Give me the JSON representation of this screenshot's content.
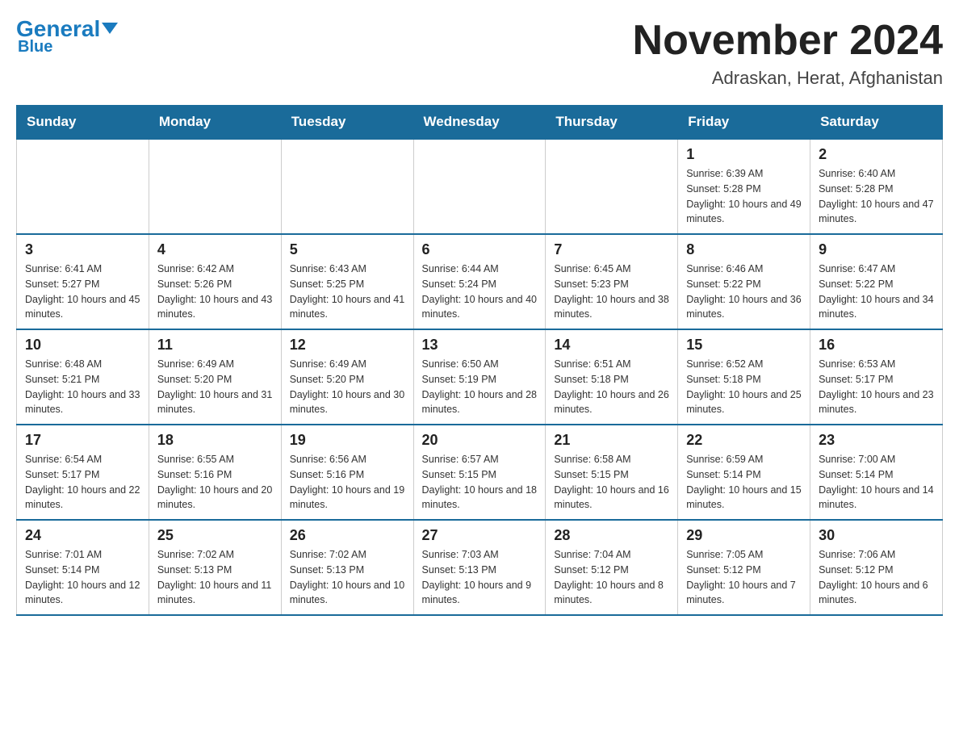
{
  "logo": {
    "general": "General",
    "blue": "Blue"
  },
  "header": {
    "month_title": "November 2024",
    "location": "Adraskan, Herat, Afghanistan"
  },
  "weekdays": [
    "Sunday",
    "Monday",
    "Tuesday",
    "Wednesday",
    "Thursday",
    "Friday",
    "Saturday"
  ],
  "weeks": [
    [
      {
        "day": "",
        "info": ""
      },
      {
        "day": "",
        "info": ""
      },
      {
        "day": "",
        "info": ""
      },
      {
        "day": "",
        "info": ""
      },
      {
        "day": "",
        "info": ""
      },
      {
        "day": "1",
        "info": "Sunrise: 6:39 AM\nSunset: 5:28 PM\nDaylight: 10 hours and 49 minutes."
      },
      {
        "day": "2",
        "info": "Sunrise: 6:40 AM\nSunset: 5:28 PM\nDaylight: 10 hours and 47 minutes."
      }
    ],
    [
      {
        "day": "3",
        "info": "Sunrise: 6:41 AM\nSunset: 5:27 PM\nDaylight: 10 hours and 45 minutes."
      },
      {
        "day": "4",
        "info": "Sunrise: 6:42 AM\nSunset: 5:26 PM\nDaylight: 10 hours and 43 minutes."
      },
      {
        "day": "5",
        "info": "Sunrise: 6:43 AM\nSunset: 5:25 PM\nDaylight: 10 hours and 41 minutes."
      },
      {
        "day": "6",
        "info": "Sunrise: 6:44 AM\nSunset: 5:24 PM\nDaylight: 10 hours and 40 minutes."
      },
      {
        "day": "7",
        "info": "Sunrise: 6:45 AM\nSunset: 5:23 PM\nDaylight: 10 hours and 38 minutes."
      },
      {
        "day": "8",
        "info": "Sunrise: 6:46 AM\nSunset: 5:22 PM\nDaylight: 10 hours and 36 minutes."
      },
      {
        "day": "9",
        "info": "Sunrise: 6:47 AM\nSunset: 5:22 PM\nDaylight: 10 hours and 34 minutes."
      }
    ],
    [
      {
        "day": "10",
        "info": "Sunrise: 6:48 AM\nSunset: 5:21 PM\nDaylight: 10 hours and 33 minutes."
      },
      {
        "day": "11",
        "info": "Sunrise: 6:49 AM\nSunset: 5:20 PM\nDaylight: 10 hours and 31 minutes."
      },
      {
        "day": "12",
        "info": "Sunrise: 6:49 AM\nSunset: 5:20 PM\nDaylight: 10 hours and 30 minutes."
      },
      {
        "day": "13",
        "info": "Sunrise: 6:50 AM\nSunset: 5:19 PM\nDaylight: 10 hours and 28 minutes."
      },
      {
        "day": "14",
        "info": "Sunrise: 6:51 AM\nSunset: 5:18 PM\nDaylight: 10 hours and 26 minutes."
      },
      {
        "day": "15",
        "info": "Sunrise: 6:52 AM\nSunset: 5:18 PM\nDaylight: 10 hours and 25 minutes."
      },
      {
        "day": "16",
        "info": "Sunrise: 6:53 AM\nSunset: 5:17 PM\nDaylight: 10 hours and 23 minutes."
      }
    ],
    [
      {
        "day": "17",
        "info": "Sunrise: 6:54 AM\nSunset: 5:17 PM\nDaylight: 10 hours and 22 minutes."
      },
      {
        "day": "18",
        "info": "Sunrise: 6:55 AM\nSunset: 5:16 PM\nDaylight: 10 hours and 20 minutes."
      },
      {
        "day": "19",
        "info": "Sunrise: 6:56 AM\nSunset: 5:16 PM\nDaylight: 10 hours and 19 minutes."
      },
      {
        "day": "20",
        "info": "Sunrise: 6:57 AM\nSunset: 5:15 PM\nDaylight: 10 hours and 18 minutes."
      },
      {
        "day": "21",
        "info": "Sunrise: 6:58 AM\nSunset: 5:15 PM\nDaylight: 10 hours and 16 minutes."
      },
      {
        "day": "22",
        "info": "Sunrise: 6:59 AM\nSunset: 5:14 PM\nDaylight: 10 hours and 15 minutes."
      },
      {
        "day": "23",
        "info": "Sunrise: 7:00 AM\nSunset: 5:14 PM\nDaylight: 10 hours and 14 minutes."
      }
    ],
    [
      {
        "day": "24",
        "info": "Sunrise: 7:01 AM\nSunset: 5:14 PM\nDaylight: 10 hours and 12 minutes."
      },
      {
        "day": "25",
        "info": "Sunrise: 7:02 AM\nSunset: 5:13 PM\nDaylight: 10 hours and 11 minutes."
      },
      {
        "day": "26",
        "info": "Sunrise: 7:02 AM\nSunset: 5:13 PM\nDaylight: 10 hours and 10 minutes."
      },
      {
        "day": "27",
        "info": "Sunrise: 7:03 AM\nSunset: 5:13 PM\nDaylight: 10 hours and 9 minutes."
      },
      {
        "day": "28",
        "info": "Sunrise: 7:04 AM\nSunset: 5:12 PM\nDaylight: 10 hours and 8 minutes."
      },
      {
        "day": "29",
        "info": "Sunrise: 7:05 AM\nSunset: 5:12 PM\nDaylight: 10 hours and 7 minutes."
      },
      {
        "day": "30",
        "info": "Sunrise: 7:06 AM\nSunset: 5:12 PM\nDaylight: 10 hours and 6 minutes."
      }
    ]
  ]
}
